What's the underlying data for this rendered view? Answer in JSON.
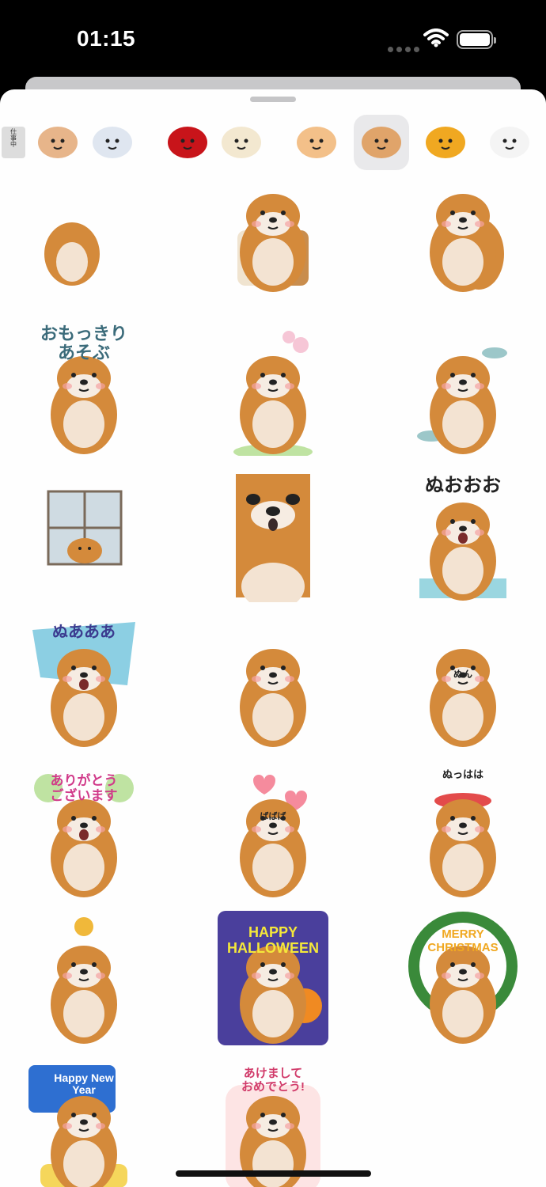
{
  "status_bar": {
    "time": "01:15"
  },
  "sticker_tabs": [
    {
      "name": "tab-sticker-set-1",
      "icon": "work-memo-icon",
      "label": "仕事中"
    },
    {
      "name": "tab-sticker-set-2",
      "icon": "girl-crying-icon"
    },
    {
      "name": "tab-sticker-set-3",
      "icon": "sketch-cat-icon"
    },
    {
      "name": "tab-sticker-set-4",
      "icon": "white-character-red-icon"
    },
    {
      "name": "tab-sticker-set-5",
      "icon": "white-bird-icon"
    },
    {
      "name": "tab-sticker-set-6",
      "icon": "shiba-dog-icon"
    },
    {
      "name": "tab-sticker-set-7",
      "icon": "otter-icon",
      "selected": true
    },
    {
      "name": "tab-sticker-set-8",
      "icon": "black-bird-yellow-icon"
    },
    {
      "name": "tab-sticker-set-9",
      "icon": "white-face-icon"
    }
  ],
  "stickers": [
    {
      "icon": "otter-partial-sticker"
    },
    {
      "icon": "otter-friends-partial-sticker"
    },
    {
      "icon": "otter-wave-partial-sticker"
    },
    {
      "icon": "otter-play-sticker",
      "text": "おもっきり\nあそぶ"
    },
    {
      "icon": "otter-sakura-sticker"
    },
    {
      "icon": "otter-fish-sticker"
    },
    {
      "icon": "otter-window-rain-sticker"
    },
    {
      "icon": "otter-closeup-face-sticker"
    },
    {
      "icon": "otter-crying-waterfall-sticker",
      "text": "ぬおおお"
    },
    {
      "icon": "otter-shout-sticker",
      "text": "ぬあああ"
    },
    {
      "icon": "otter-lying-steam-sticker"
    },
    {
      "icon": "otter-stretch-sticker",
      "text": "ぬん"
    },
    {
      "icon": "otter-thank-you-sticker",
      "text": "ありがとう\nございます"
    },
    {
      "icon": "otter-hearts-sticker",
      "text": "ばばば"
    },
    {
      "icon": "otter-dance-sticker",
      "text": "ぬっはは"
    },
    {
      "icon": "otter-muscle-sticker"
    },
    {
      "icon": "otter-halloween-sticker",
      "text": "HAPPY\nHALLOWEEN"
    },
    {
      "icon": "otter-christmas-sticker",
      "text": "MERRY\nCHRISTMAS"
    },
    {
      "icon": "otter-new-year-sled-sticker",
      "text": "Happy New\nYear"
    },
    {
      "icon": "otter-new-year-greeting-sticker",
      "text": "あけまして\nおめでとう!"
    }
  ]
}
